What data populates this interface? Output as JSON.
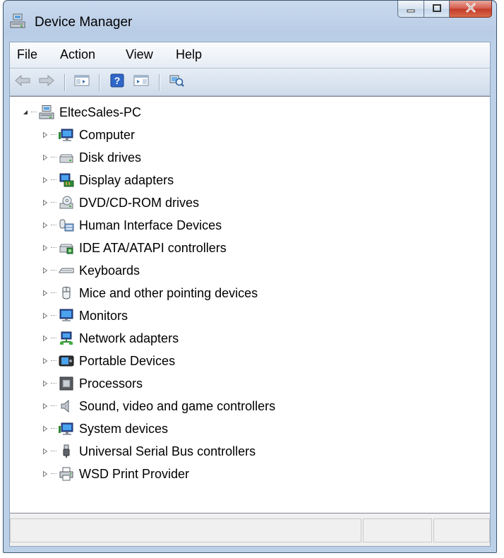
{
  "window": {
    "title": "Device Manager",
    "accent": "#b8cce5",
    "close_color": "#c23a28"
  },
  "menu": [
    "File",
    "Action",
    "View",
    "Help"
  ],
  "toolbar": {
    "buttons": [
      "back-arrow-icon",
      "forward-arrow-icon",
      "show-hide-console-tree-icon",
      "help-icon",
      "show-hide-action-pane-icon",
      "scan-hardware-changes-icon"
    ]
  },
  "tree": {
    "root": {
      "label": "EltecSales-PC",
      "icon": "computer-network-icon",
      "expanded": true
    },
    "children": [
      {
        "label": "Computer",
        "icon": "computer-icon"
      },
      {
        "label": "Disk drives",
        "icon": "disk-drive-icon"
      },
      {
        "label": "Display adapters",
        "icon": "display-adapter-icon"
      },
      {
        "label": "DVD/CD-ROM drives",
        "icon": "dvd-drive-icon"
      },
      {
        "label": "Human Interface Devices",
        "icon": "hid-icon"
      },
      {
        "label": "IDE ATA/ATAPI controllers",
        "icon": "ide-controller-icon"
      },
      {
        "label": "Keyboards",
        "icon": "keyboard-icon"
      },
      {
        "label": "Mice and other pointing devices",
        "icon": "mouse-icon"
      },
      {
        "label": "Monitors",
        "icon": "monitor-icon"
      },
      {
        "label": "Network adapters",
        "icon": "network-adapter-icon"
      },
      {
        "label": "Portable Devices",
        "icon": "portable-device-icon"
      },
      {
        "label": "Processors",
        "icon": "processor-icon"
      },
      {
        "label": "Sound, video and game controllers",
        "icon": "speaker-icon"
      },
      {
        "label": "System devices",
        "icon": "system-devices-icon"
      },
      {
        "label": "Universal Serial Bus controllers",
        "icon": "usb-icon"
      },
      {
        "label": "WSD Print Provider",
        "icon": "printer-icon"
      }
    ]
  }
}
